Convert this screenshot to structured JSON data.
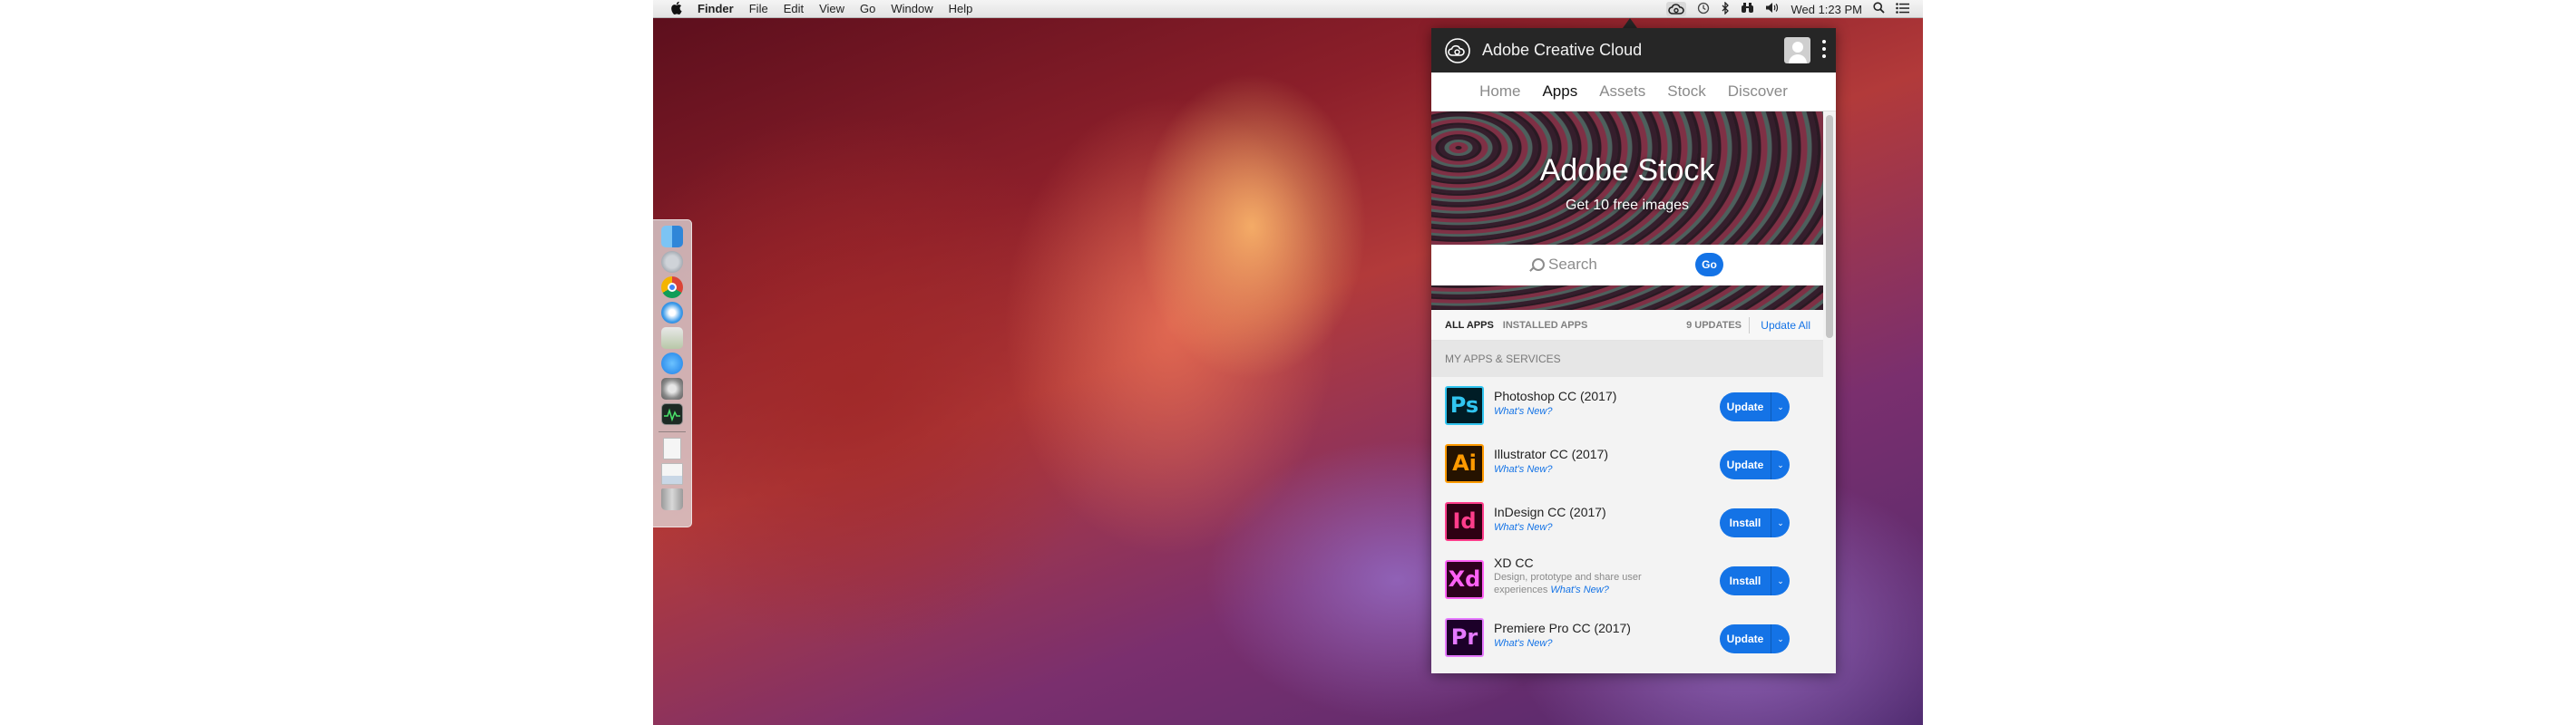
{
  "menubar": {
    "apple": "",
    "app_name": "Finder",
    "menus": [
      "File",
      "Edit",
      "View",
      "Go",
      "Window",
      "Help"
    ],
    "clock": "Wed 1:23 PM",
    "status_icons": [
      "creative-cloud-icon",
      "time-machine-icon",
      "bluetooth-icon",
      "binoculars-icon",
      "volume-icon",
      "search-icon",
      "list-icon"
    ]
  },
  "dock": {
    "items": [
      "finder-icon",
      "launchpad-icon",
      "chrome-icon",
      "safari-icon",
      "preview-icon",
      "app-store-icon",
      "system-preferences-icon",
      "activity-monitor-icon",
      "document-icon",
      "photo-icon",
      "trash-icon"
    ]
  },
  "panel": {
    "title": "Adobe Creative Cloud",
    "tabs": [
      "Home",
      "Apps",
      "Assets",
      "Stock",
      "Discover"
    ],
    "active_tab": "Apps",
    "stock": {
      "title": "Adobe Stock",
      "subtitle": "Get 10 free images",
      "search_placeholder": "Search",
      "go_label": "Go"
    },
    "filters": {
      "all_apps": "ALL APPS",
      "installed_apps": "INSTALLED APPS",
      "updates": "9 UPDATES",
      "update_all": "Update All"
    },
    "section_header": "MY APPS & SERVICES",
    "apps": [
      {
        "abbr": "Ps",
        "name": "Photoshop CC (2017)",
        "whats_new": "What's New?",
        "action": "Update",
        "bg": "#001d26",
        "fg": "#31c5f0",
        "border": "#31c5f0"
      },
      {
        "abbr": "Ai",
        "name": "Illustrator CC (2017)",
        "whats_new": "What's New?",
        "action": "Update",
        "bg": "#261300",
        "fg": "#ff9a00",
        "border": "#ff9a00"
      },
      {
        "abbr": "Id",
        "name": "InDesign CC (2017)",
        "whats_new": "What's New?",
        "action": "Install",
        "bg": "#2e0013",
        "fg": "#ff3d8b",
        "border": "#ff3d8b"
      },
      {
        "abbr": "Xd",
        "name": "XD CC",
        "description": "Design, prototype and share user experiences",
        "whats_new": "What's New?",
        "action": "Install",
        "bg": "#2e001e",
        "fg": "#ff61f6",
        "border": "#ff61f6"
      },
      {
        "abbr": "Pr",
        "name": "Premiere Pro CC (2017)",
        "whats_new": "What's New?",
        "action": "Update",
        "bg": "#1c0029",
        "fg": "#e579ff",
        "border": "#e579ff"
      }
    ],
    "chevron": "⌄"
  },
  "colors": {
    "accent": "#1473e6",
    "header_bg": "#262626"
  }
}
